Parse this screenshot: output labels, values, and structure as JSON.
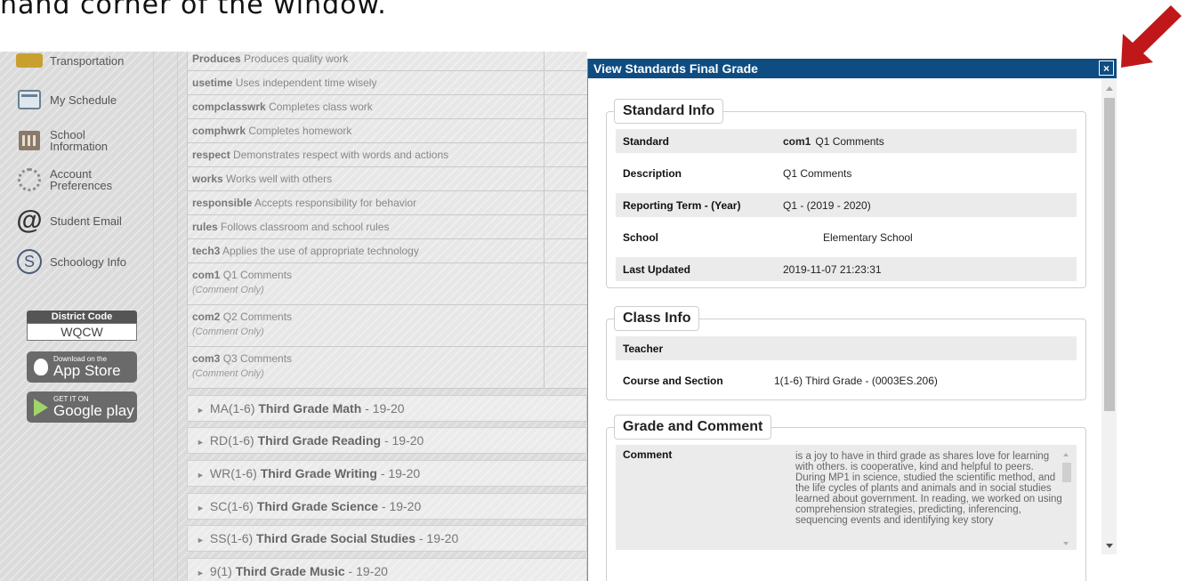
{
  "caption": "hand corner of the window.",
  "sidebar": {
    "items": [
      {
        "label": "Transportation",
        "icon": "bus-icon"
      },
      {
        "label": "My Schedule",
        "icon": "calendar-clock-icon"
      },
      {
        "label": "School Information",
        "icon": "school-building-icon"
      },
      {
        "label": "Account Preferences",
        "icon": "gear-person-icon"
      },
      {
        "label": "Student Email",
        "icon": "at-sign-icon"
      },
      {
        "label": "Schoology Info",
        "icon": "schoology-s-icon"
      }
    ],
    "district_code_label": "District Code",
    "district_code_value": "WQCW",
    "app_store_small": "Download on the",
    "app_store_large": "App Store",
    "google_play_small": "GET IT ON",
    "google_play_large": "Google play"
  },
  "standards": [
    {
      "code": "Produces",
      "desc": "Produces quality work",
      "sub": ""
    },
    {
      "code": "usetime",
      "desc": "Uses independent time wisely",
      "sub": ""
    },
    {
      "code": "compclasswrk",
      "desc": "Completes class work",
      "sub": ""
    },
    {
      "code": "comphwrk",
      "desc": "Completes homework",
      "sub": ""
    },
    {
      "code": "respect",
      "desc": "Demonstrates respect with words and actions",
      "sub": ""
    },
    {
      "code": "works",
      "desc": "Works well with others",
      "sub": ""
    },
    {
      "code": "responsible",
      "desc": "Accepts responsibility for behavior",
      "sub": ""
    },
    {
      "code": "rules",
      "desc": "Follows classroom and school rules",
      "sub": ""
    },
    {
      "code": "tech3",
      "desc": "Applies the use of appropriate technology",
      "sub": ""
    },
    {
      "code": "com1",
      "desc": "Q1 Comments",
      "sub": "(Comment Only)"
    },
    {
      "code": "com2",
      "desc": "Q2 Comments",
      "sub": "(Comment Only)"
    },
    {
      "code": "com3",
      "desc": "Q3 Comments",
      "sub": "(Comment Only)"
    }
  ],
  "courses": [
    {
      "prefix": "MA(1-6)",
      "name": "Third Grade Math",
      "year": "- 19-20"
    },
    {
      "prefix": "RD(1-6)",
      "name": "Third Grade Reading",
      "year": "- 19-20"
    },
    {
      "prefix": "WR(1-6)",
      "name": "Third Grade Writing",
      "year": "- 19-20"
    },
    {
      "prefix": "SC(1-6)",
      "name": "Third Grade Science",
      "year": "- 19-20"
    },
    {
      "prefix": "SS(1-6)",
      "name": "Third Grade Social Studies",
      "year": "- 19-20"
    },
    {
      "prefix": "9(1)",
      "name": "Third Grade Music",
      "year": "- 19-20"
    }
  ],
  "modal": {
    "title": "View Standards Final Grade",
    "close_label": "×",
    "standard_info": {
      "legend": "Standard Info",
      "standard_label": "Standard",
      "standard_code": "com1",
      "standard_name": "Q1 Comments",
      "description_label": "Description",
      "description_value": "Q1 Comments",
      "term_label": "Reporting Term - (Year)",
      "term_value": "Q1  -  (2019 - 2020)",
      "school_label": "School",
      "school_value": "Elementary School",
      "updated_label": "Last Updated",
      "updated_value": "2019-11-07 21:23:31"
    },
    "class_info": {
      "legend": "Class Info",
      "teacher_label": "Teacher",
      "teacher_value": "",
      "course_label": "Course and Section",
      "course_value": "1(1-6) Third Grade  -  (0003ES.206)"
    },
    "grade_comment": {
      "legend": "Grade and Comment",
      "comment_label": "Comment",
      "comment_value": "        is a joy to have in third grade as      shares love for learning with others.      is cooperative, kind and helpful to      peers. During MP1 in science,      studied the scientific method, and the life cycles of plants and animals and in social studies learned about government. In reading, we worked on using comprehension strategies, predicting, inferencing, sequencing events and identifying key story"
    }
  },
  "colors": {
    "modal_header": "#0f4c81",
    "arrow": "#c0171a"
  }
}
